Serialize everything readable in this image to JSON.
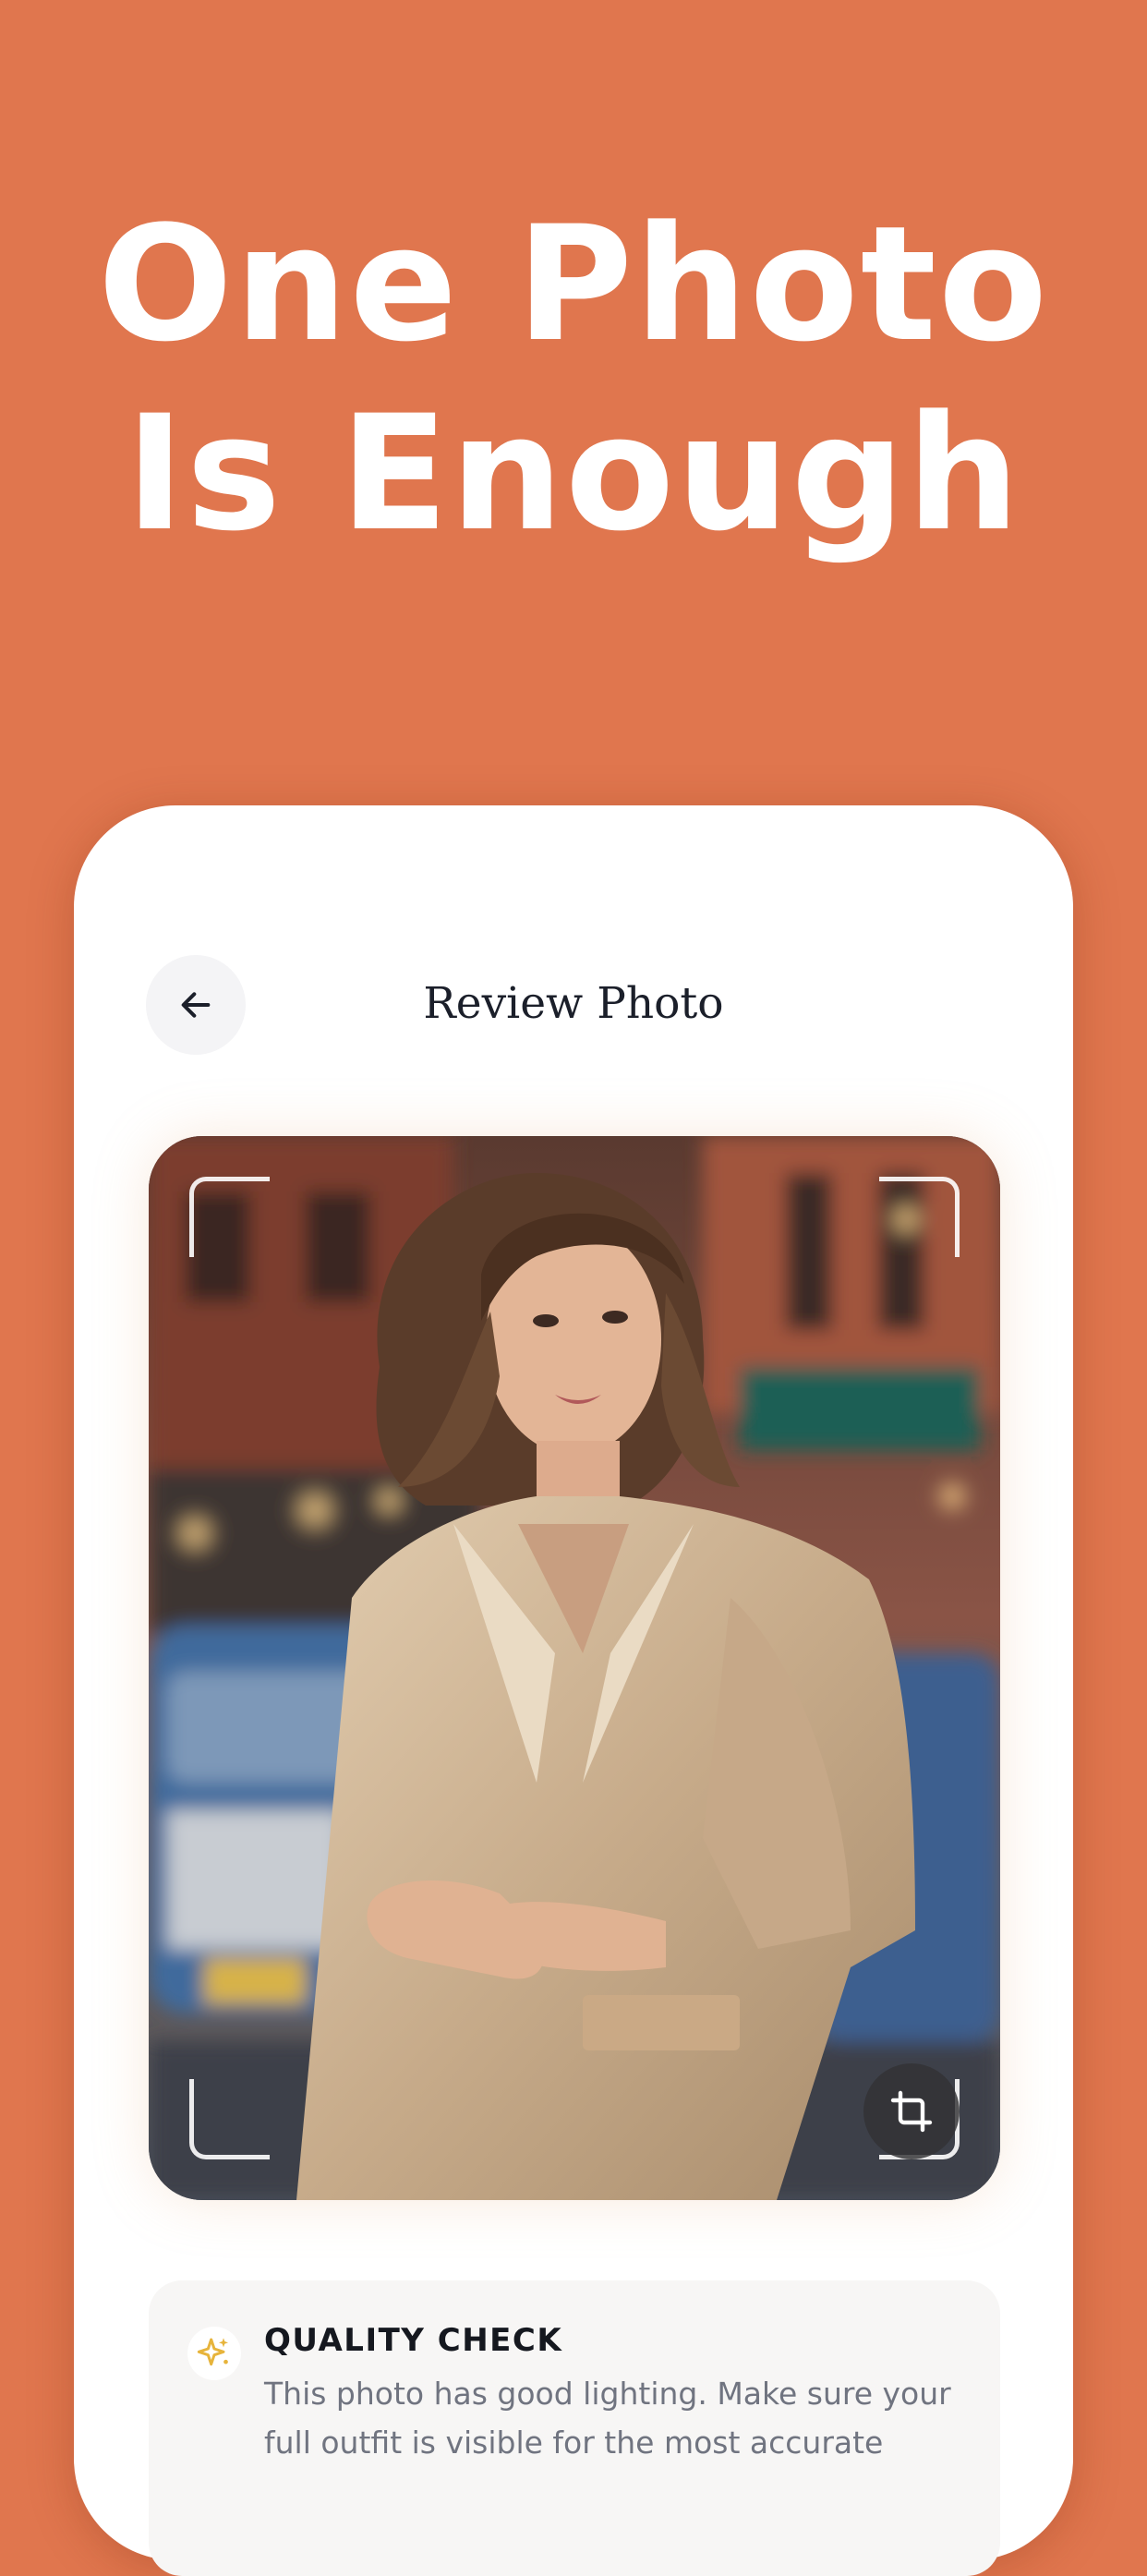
{
  "headline": {
    "line1": "One Photo",
    "line2": "Is Enough"
  },
  "screen": {
    "title": "Review Photo",
    "back_icon": "arrow-left-icon"
  },
  "photo": {
    "crop_icon": "crop-icon"
  },
  "quality_check": {
    "icon": "sparkle-icon",
    "title": "QUALITY CHECK",
    "body": "This photo has good lighting. Make sure your full outfit is visible for the most accurate"
  },
  "colors": {
    "background": "#E0764E",
    "card": "#FFFFFF",
    "title_text": "#1B1F2A",
    "body_text": "#707480",
    "sparkle": "#E7B43B"
  }
}
